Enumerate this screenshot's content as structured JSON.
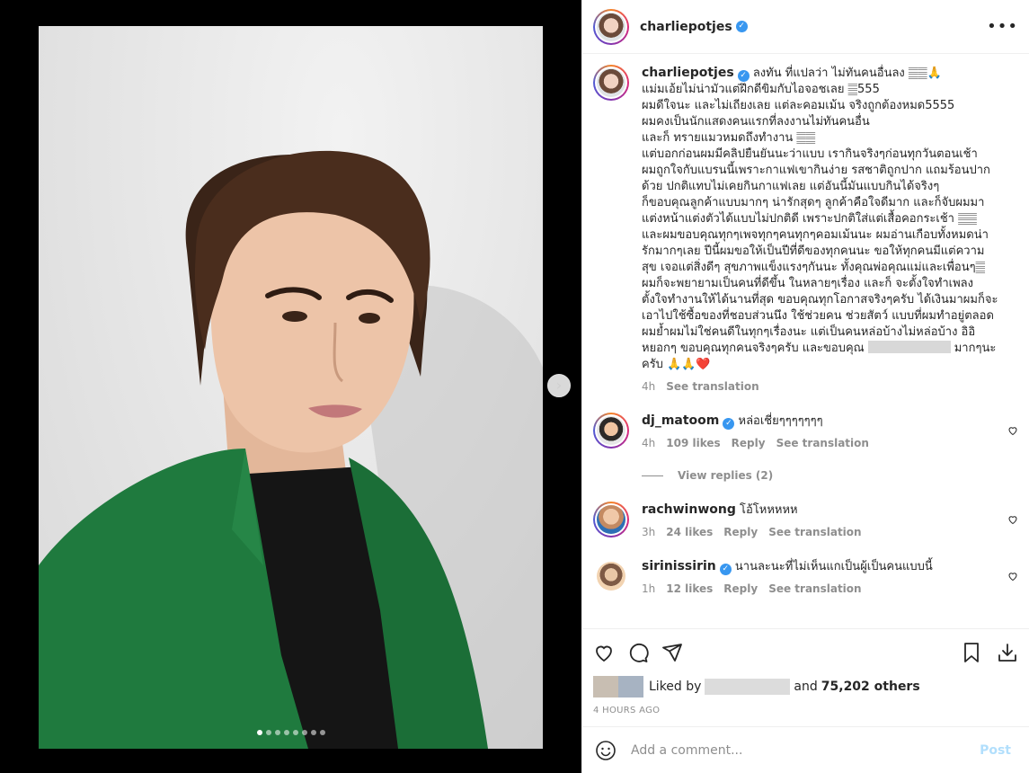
{
  "post": {
    "username": "charliepotjes",
    "verified_icon": "verified-badge-icon",
    "more_icon": "more-options-icon",
    "image_dots": 8,
    "image_active_index": 0
  },
  "caption": {
    "username": "charliepotjes",
    "text": "ลงทัน ที่แปลว่า ไม่ทันคนอื่นลง 𝄛𝄛🙏\nแม่มเอ้ยไม่น่ามัวแต่ฝึกดีขิมกับไอจอชเลย 𝄛555\nผมดีใจนะ และไม่เถียงเลย แต่ละคอมเม้น จริงถูกต้องหมด5555\nผมคงเป็นนักแสดงคนแรกที่ลงงานไม่ทันคนอื่น\nและก็ ทรายแมวหมดถึงทำงาน 𝄛𝄛\nแต่บอกก่อนผมมีคลิปยืนยันนะว่าแบบ เรากินจริงๆก่อนทุกวันตอนเช้า\nผมถูกใจกับแบรนนี้เพราะกาแฟเขากินง่าย รสชาติถูกปาก แถมร้อนปาก\nด้วย ปกติแทบไม่เคยกินกาแฟเลย แต่อันนี้มันแบบกินได้จริงๆ\nก็ขอบคุณลูกค้าแบบมากๆ น่ารักสุดๆ ลูกค้าคือใจดีมาก และก็จับผมมา\nแต่งหน้าแต่งตัวได้แบบไม่ปกติดี เพราะปกติใส่แต่เสื้อคอกระเช้า 𝄛𝄛\nและผมขอบคุณทุกๆเพจทุกๆคนทุกๆคอมเม้นนะ ผมอ่านเกือบทั้งหมดน่า\nรักมากๆเลย ปีนี้ผมขอให้เป็นปีที่ดีของทุกคนนะ ขอให้ทุกคนมีแต่ความ\nสุข เจอแต่สิ่งดีๆ สุขภาพแข็งแรงๆกันนะ ทั้งคุณพ่อคุณแม่และเพื่อนๆ𝄛\nผมก็จะพยายามเป็นคนที่ดีขึ้น ในหลายๆเรื่อง และก็ จะตั้งใจทำเพลง\nตั้งใจทำงานให้ได้นานที่สุด ขอบคุณทุกโอกาสจริงๆครับ ได้เงินมาผมก็จะ\nเอาไปใช้ซื้อของที่ชอบส่วนนึง ใช้ช่วยคน ช่วยสัตว์ แบบที่ผมทำอยู่ตลอด\nผมย้ำผมไม่ใช่คนดีในทุกๆเรื่องนะ แต่เป็นคนหล่อบ้างไม่หล่อบ้าง อิอิ\nหยอกๆ ขอบคุณทุกคนจริงๆครับ และขอบคุณ",
    "text_end": "มากๆนะ\nครับ 🙏🙏❤️",
    "time": "4h",
    "see_translation": "See translation"
  },
  "comments": [
    {
      "username": "dj_matoom",
      "verified": true,
      "text": "หล่อเชี่ยๆๆๆๆๆๆๆ",
      "time": "4h",
      "likes": "109 likes",
      "reply": "Reply",
      "see_translation": "See translation",
      "view_replies": "View replies (2)"
    },
    {
      "username": "rachwinwong",
      "verified": false,
      "text": "โอ้โหหหหห",
      "time": "3h",
      "likes": "24 likes",
      "reply": "Reply",
      "see_translation": "See translation"
    },
    {
      "username": "sirinissirin",
      "verified": true,
      "text": "นานละนะที่ไม่เห็นแกเป็นผู้เป็นคนแบบนี้",
      "time": "1h",
      "likes": "12 likes",
      "reply": "Reply",
      "see_translation": "See translation"
    }
  ],
  "actions": {
    "like_icon": "heart-icon",
    "comment_icon": "comment-icon",
    "share_icon": "share-icon",
    "save_icon": "bookmark-icon",
    "download_icon": "download-icon"
  },
  "likes": {
    "prefix": "Liked by",
    "and": "and",
    "count": "75,202 others"
  },
  "time_ago": "4 HOURS AGO",
  "add_comment": {
    "placeholder": "Add a comment...",
    "post_label": "Post",
    "emoji_icon": "emoji-icon"
  },
  "colors": {
    "verified": "#3897f0",
    "post_button": "#b2dffc",
    "suit_green": "#1f7a3e"
  }
}
